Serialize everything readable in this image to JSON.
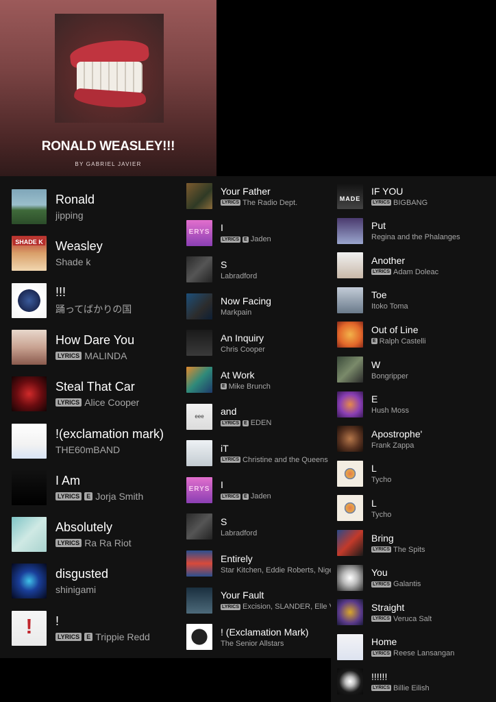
{
  "header": {
    "title": "RONALD WEASLEY!!!",
    "by": "BY GABRIEL JAVIER",
    "cover_icon": "album-cover-lips-teeth"
  },
  "labels": {
    "lyrics": "LYRICS",
    "explicit": "E"
  },
  "columns": [
    [
      {
        "title": "Ronald",
        "subtitle": "jipping",
        "lyrics": false,
        "explicit": false,
        "art": "linear-gradient(180deg,#7fa6b9 0%,#9bbfcc 45%,#3f6a3a 60%,#2c4d2a 100%)"
      },
      {
        "title": "Weasley",
        "subtitle": "Shade k",
        "lyrics": false,
        "explicit": false,
        "art": "linear-gradient(180deg,#b62e2c 0%,#d9a06a 50%,#f1d7b0 100%)",
        "glyph": "SHADE K"
      },
      {
        "title": "!!!",
        "subtitle": "踊ってばかりの国",
        "lyrics": false,
        "explicit": false,
        "art": "radial-gradient(circle,#3a5a9a 0%,#1c2a55 45%,#ffffff 46%,#f4f4f4 100%)"
      },
      {
        "title": "How Dare You",
        "subtitle": "MALINDA",
        "lyrics": true,
        "explicit": false,
        "art": "linear-gradient(180deg,#e8d8cc 0%,#c9a392 50%,#8a5a4d 100%)"
      },
      {
        "title": "Steal That Car",
        "subtitle": "Alice Cooper",
        "lyrics": true,
        "explicit": false,
        "art": "radial-gradient(circle,#d12a2a 0%,#6a0c10 50%,#140404 100%)"
      },
      {
        "title": "!(exclamation mark)",
        "subtitle": "THE60mBAND",
        "lyrics": false,
        "explicit": false,
        "art": "linear-gradient(180deg,#ffffff 0%,#f2f2f2 60%,#d8e4f4 100%)"
      },
      {
        "title": "I Am",
        "subtitle": "Jorja Smith",
        "lyrics": true,
        "explicit": true,
        "art": "linear-gradient(180deg,#111 0%,#000 100%)"
      },
      {
        "title": "Absolutely",
        "subtitle": "Ra Ra Riot",
        "lyrics": true,
        "explicit": false,
        "art": "linear-gradient(135deg,#7fc4c6 0%,#cfe9e4 50%,#a9d3cf 100%)"
      },
      {
        "title": "disgusted",
        "subtitle": "shinigami",
        "lyrics": false,
        "explicit": false,
        "art": "radial-gradient(circle,#3fc1e8 0%,#1a3f9a 40%,#05081c 100%)"
      },
      {
        "title": "!",
        "subtitle": "Trippie Redd",
        "lyrics": true,
        "explicit": true,
        "art": "linear-gradient(180deg,#f6f6f6 0%,#eaeaea 100%)",
        "glyph": "!"
      }
    ],
    [
      {
        "title": "Your Father",
        "subtitle": "The Radio Dept.",
        "lyrics": true,
        "explicit": false,
        "art": "linear-gradient(135deg,#7c5a2e 0%,#2f3a25 60%,#8a6b3a 100%)"
      },
      {
        "title": "I",
        "subtitle": "Jaden",
        "lyrics": true,
        "explicit": true,
        "art": "linear-gradient(180deg,#e26fcd 0%,#8a3fb3 100%)",
        "glyph": "ERYS"
      },
      {
        "title": "S",
        "subtitle": "Labradford",
        "lyrics": false,
        "explicit": false,
        "art": "linear-gradient(135deg,#2a2a2a 0%,#555 50%,#222 100%)"
      },
      {
        "title": "Now Facing",
        "subtitle": "Markpain",
        "lyrics": false,
        "explicit": false,
        "art": "linear-gradient(135deg,#1c4f7a 0%,#2c2c2c 60%,#0d1f35 100%)"
      },
      {
        "title": "An Inquiry",
        "subtitle": "Chris Cooper",
        "lyrics": false,
        "explicit": false,
        "art": "linear-gradient(180deg,#1a1a1a 0%,#3a3a3a 100%)"
      },
      {
        "title": "At Work",
        "subtitle": "Mike Brunch",
        "lyrics": false,
        "explicit": true,
        "art": "linear-gradient(135deg,#e08a2e 0%,#2f8a7a 50%,#1e3a6a 100%)"
      },
      {
        "title": "and",
        "subtitle": "EDEN",
        "lyrics": true,
        "explicit": true,
        "art": "linear-gradient(180deg,#f1f1f1 0%,#dcdcdc 100%)",
        "glyph": "eee"
      },
      {
        "title": "iT",
        "subtitle": "Christine and the Queens",
        "lyrics": true,
        "explicit": false,
        "art": "linear-gradient(180deg,#eef2f5 0%,#c3cbd1 100%)"
      },
      {
        "title": "I",
        "subtitle": "Jaden",
        "lyrics": true,
        "explicit": true,
        "art": "linear-gradient(180deg,#e26fcd 0%,#8a3fb3 100%)",
        "glyph": "ERYS"
      },
      {
        "title": "S",
        "subtitle": "Labradford",
        "lyrics": false,
        "explicit": false,
        "art": "linear-gradient(135deg,#2a2a2a 0%,#555 50%,#222 100%)"
      },
      {
        "title": "Entirely",
        "subtitle": "Star Kitchen, Eddie Roberts, Nigel Hall",
        "lyrics": false,
        "explicit": false,
        "art": "linear-gradient(180deg,#2b4f8f 0%,#d94a3a 50%,#2b4f8f 100%)"
      },
      {
        "title": "Your Fault",
        "subtitle": "Excision, SLANDER, Elle Vee",
        "lyrics": true,
        "explicit": false,
        "art": "linear-gradient(180deg,#1a2f3f 0%,#4d6a7a 100%)"
      },
      {
        "title": "! (Exclamation Mark)",
        "subtitle": "The Senior Allstars",
        "lyrics": false,
        "explicit": false,
        "art": "radial-gradient(circle,#222 0%,#222 42%,#ffffff 44%,#ffffff 100%)"
      }
    ],
    [
      {
        "title": "IF YOU",
        "subtitle": "BIGBANG",
        "lyrics": true,
        "explicit": false,
        "art": "linear-gradient(180deg,#111 0%,#444 100%)",
        "glyph": "MADE"
      },
      {
        "title": "Put",
        "subtitle": "Regina and the Phalanges",
        "lyrics": false,
        "explicit": false,
        "art": "linear-gradient(180deg,#4a3a6e 0%,#9aa6ce 100%)"
      },
      {
        "title": "Another",
        "subtitle": "Adam Doleac",
        "lyrics": true,
        "explicit": false,
        "art": "linear-gradient(180deg,#f1f1f1 0%,#c8b8a8 100%)"
      },
      {
        "title": "Toe",
        "subtitle": "Itoko Toma",
        "lyrics": false,
        "explicit": false,
        "art": "linear-gradient(180deg,#c3ccd8 0%,#6a7a8a 100%)"
      },
      {
        "title": "Out of Line",
        "subtitle": "Ralph Castelli",
        "lyrics": false,
        "explicit": true,
        "art": "radial-gradient(circle,#f2b24a 0%,#e2672a 60%,#8a2a1a 100%)"
      },
      {
        "title": "W",
        "subtitle": "Bongripper",
        "lyrics": false,
        "explicit": false,
        "art": "linear-gradient(135deg,#3a4a3a 0%,#7a8a6a 50%,#2a2a2a 100%)"
      },
      {
        "title": "E",
        "subtitle": "Hush Moss",
        "lyrics": false,
        "explicit": false,
        "art": "radial-gradient(circle,#e6894a 0%,#8a3fb3 55%,#3a1a5a 100%)"
      },
      {
        "title": "Apostrophe'",
        "subtitle": "Frank Zappa",
        "lyrics": false,
        "explicit": false,
        "art": "radial-gradient(circle,#b5774a 0%,#5a3320 55%,#1a0f0a 100%)"
      },
      {
        "title": "L",
        "subtitle": "Tycho",
        "lyrics": false,
        "explicit": false,
        "art": "radial-gradient(circle,#e6794a 0%,#e6a64a 22%,#4a6fb3 30%,#f3ede2 31%,#f3ede2 100%)"
      },
      {
        "title": "L",
        "subtitle": "Tycho",
        "lyrics": false,
        "explicit": false,
        "art": "radial-gradient(circle,#e6794a 0%,#e6a64a 22%,#4a6fb3 30%,#f3ede2 31%,#f3ede2 100%)"
      },
      {
        "title": "Bring",
        "subtitle": "The Spits",
        "lyrics": true,
        "explicit": false,
        "art": "linear-gradient(135deg,#2a4a8a 0%,#c33a2a 50%,#1a1a1a 100%)"
      },
      {
        "title": "You",
        "subtitle": "Galantis",
        "lyrics": true,
        "explicit": false,
        "art": "radial-gradient(circle,#ffffff 0%,#bbbbbb 40%,#2a2a2a 100%)"
      },
      {
        "title": "Straight",
        "subtitle": "Veruca Salt",
        "lyrics": true,
        "explicit": false,
        "art": "radial-gradient(circle,#d9a62a 0%,#5a3a8a 60%,#1a1a3a 100%)"
      },
      {
        "title": "Home",
        "subtitle": "Reese Lansangan",
        "lyrics": true,
        "explicit": false,
        "art": "linear-gradient(180deg,#f3f3f6 0%,#dde3f0 100%)"
      },
      {
        "title": "!!!!!!",
        "subtitle": "Billie Eilish",
        "lyrics": true,
        "explicit": false,
        "art": "radial-gradient(circle,#ffffff 0%,#bfbfbf 25%,#1a1a1a 60%,#0a0a0a 100%)"
      }
    ]
  ]
}
